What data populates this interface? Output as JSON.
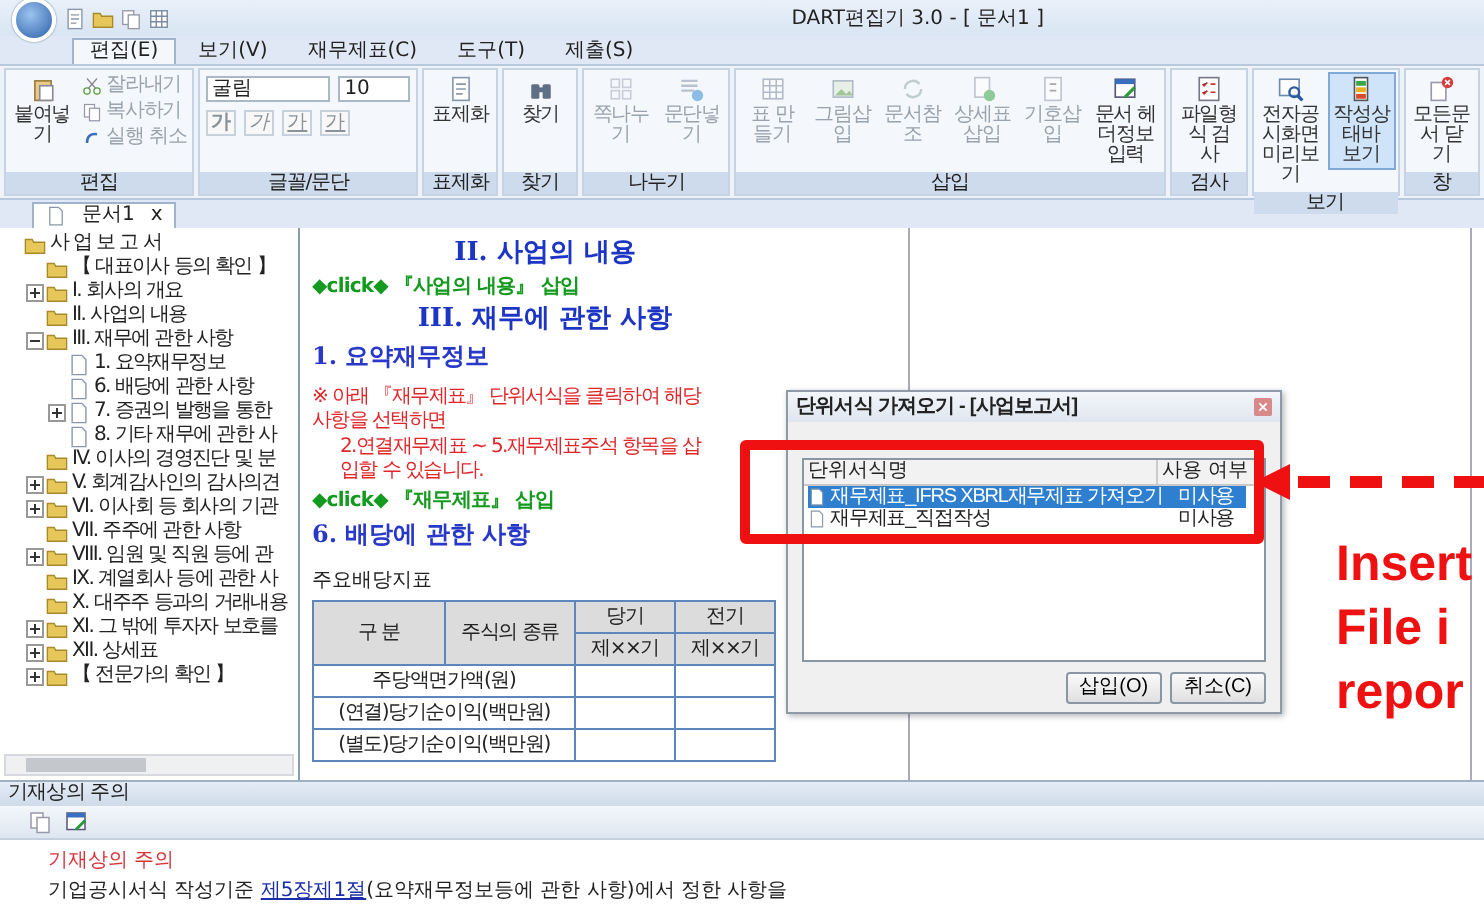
{
  "window": {
    "title": "DART편집기 3.0 - [ 문서1 ]"
  },
  "ribbon_tabs": [
    {
      "label": "편집(E)",
      "selected": true
    },
    {
      "label": "보기(V)",
      "selected": false
    },
    {
      "label": "재무제표(C)",
      "selected": false
    },
    {
      "label": "도구(T)",
      "selected": false
    },
    {
      "label": "제출(S)",
      "selected": false
    }
  ],
  "ribbon_groups": [
    {
      "label": "편집",
      "buttons": [
        {
          "label": "붙여넣기",
          "kind": "large",
          "disabled": false,
          "pressed": false
        },
        {
          "label": "잘라내기",
          "kind": "small",
          "disabled": true,
          "pressed": false
        },
        {
          "label": "복사하기",
          "kind": "small",
          "disabled": true,
          "pressed": false
        },
        {
          "label": "실행 취소",
          "kind": "small",
          "disabled": true,
          "pressed": false
        }
      ]
    },
    {
      "label": "글꼴/문단",
      "font_name": "굴림",
      "font_size": "10",
      "format_buttons": [
        "가",
        "가",
        "가",
        "가"
      ]
    },
    {
      "label": "표제화",
      "buttons": [
        {
          "label": "표제화",
          "kind": "large",
          "disabled": false,
          "pressed": false
        }
      ]
    },
    {
      "label": "찾기",
      "buttons": [
        {
          "label": "찾기",
          "kind": "large",
          "disabled": false,
          "pressed": false
        }
      ]
    },
    {
      "label": "나누기",
      "buttons": [
        {
          "label": "쪽나누기",
          "kind": "large",
          "disabled": true,
          "pressed": false
        },
        {
          "label": "문단넣기",
          "kind": "large",
          "disabled": true,
          "pressed": false
        }
      ]
    },
    {
      "label": "삽입",
      "buttons": [
        {
          "label": "표 만들기",
          "kind": "large",
          "disabled": true,
          "pressed": false
        },
        {
          "label": "그림삽입",
          "kind": "large",
          "disabled": true,
          "pressed": false
        },
        {
          "label": "문서참조",
          "kind": "large",
          "disabled": true,
          "pressed": false
        },
        {
          "label": "상세표삽입",
          "kind": "large",
          "disabled": true,
          "pressed": false
        },
        {
          "label": "기호삽입",
          "kind": "large",
          "disabled": true,
          "pressed": false
        },
        {
          "label": "문서 헤더정보 입력",
          "kind": "large",
          "disabled": false,
          "pressed": false
        }
      ]
    },
    {
      "label": "검사",
      "buttons": [
        {
          "label": "파일형식 검사",
          "kind": "large",
          "disabled": false,
          "pressed": false
        }
      ]
    },
    {
      "label": "보기",
      "buttons": [
        {
          "label": "전자공시화면 미리보기",
          "kind": "large",
          "disabled": false,
          "pressed": false
        },
        {
          "label": "작성상태바 보기",
          "kind": "large",
          "disabled": false,
          "pressed": true
        }
      ]
    },
    {
      "label": "창",
      "buttons": [
        {
          "label": "모든문서 닫기",
          "kind": "large",
          "disabled": false,
          "pressed": false
        }
      ]
    }
  ],
  "doc_tab": {
    "label": "문서1",
    "close": "x"
  },
  "tree": {
    "label": "사 업 보 고 서",
    "kind": "folder",
    "children": [
      {
        "label": "【 대표이사 등의 확인 】",
        "kind": "folder"
      },
      {
        "label": "I. 회사의 개요",
        "kind": "folder",
        "expanded": false
      },
      {
        "label": "II. 사업의 내용",
        "kind": "folder"
      },
      {
        "label": "III. 재무에 관한 사항",
        "kind": "folder",
        "expanded": true,
        "children": [
          {
            "label": "1. 요약재무정보",
            "kind": "page"
          },
          {
            "label": "6. 배당에 관한 사항",
            "kind": "page"
          },
          {
            "label": "7. 증권의 발행을 통한",
            "kind": "page",
            "expanded": false
          },
          {
            "label": "8. 기타 재무에 관한 사",
            "kind": "page"
          }
        ]
      },
      {
        "label": "IV. 이사의 경영진단 및 분",
        "kind": "folder"
      },
      {
        "label": "V. 회계감사인의 감사의견",
        "kind": "folder",
        "expanded": false
      },
      {
        "label": "VI. 이사회 등 회사의 기관",
        "kind": "folder",
        "expanded": false
      },
      {
        "label": "VII. 주주에 관한 사항",
        "kind": "folder"
      },
      {
        "label": "VIII. 임원 및 직원 등에 관",
        "kind": "folder",
        "expanded": false
      },
      {
        "label": "IX. 계열회사 등에 관한 사",
        "kind": "folder"
      },
      {
        "label": "X. 대주주 등과의 거래내용",
        "kind": "folder"
      },
      {
        "label": "XI. 그 밖에 투자자 보호를",
        "kind": "folder",
        "expanded": false
      },
      {
        "label": "XII. 상세표",
        "kind": "folder",
        "expanded": false
      },
      {
        "label": "【 전문가의 확인 】",
        "kind": "folder",
        "expanded": false
      }
    ]
  },
  "document": {
    "blocks": [
      {
        "kind": "title",
        "text": "II. 사업의 내용"
      },
      {
        "kind": "action",
        "text": "◆click◆ 『사업의 내용』 삽입"
      },
      {
        "kind": "title",
        "text": "III. 재무에 관한 사항"
      },
      {
        "kind": "heading",
        "text": "1. 요약재무정보"
      },
      {
        "kind": "note",
        "text": "※ 아래 『재무제표』 단위서식을 클릭하여 해당사항을 선택하면"
      },
      {
        "kind": "note",
        "text": "2.연결재무제표 ~ 5.재무제표주석 항목을 삽입할 수 있습니다."
      },
      {
        "kind": "action",
        "text": "◆click◆ 『재무제표』 삽입"
      },
      {
        "kind": "heading",
        "text": "6. 배당에 관한 사항"
      },
      {
        "kind": "caption",
        "text": "주요배당지표"
      }
    ],
    "table": {
      "header": [
        "구 분",
        "주식의 종류",
        "당기",
        "전기"
      ],
      "subheader": [
        "제××기",
        "제××기"
      ],
      "rows": [
        "주당액면가액(원)",
        "(연결)당기순이익(백만원)",
        "(별도)당기순이익(백만원)"
      ]
    }
  },
  "dialog": {
    "title": "단위서식 가져오기 - [사업보고서]",
    "columns": [
      "단위서식명",
      "사용 여부"
    ],
    "rows": [
      {
        "name": "재무제표_IFRS XBRL재무제표 가져오기",
        "usage": "미사용",
        "selected": true
      },
      {
        "name": "재무제표_직접작성",
        "usage": "미사용",
        "selected": false
      }
    ],
    "buttons": [
      "삽입(O)",
      "취소(C)"
    ]
  },
  "annotation": {
    "lines": [
      "Insert",
      "File i",
      "repor"
    ]
  },
  "notes_panel": {
    "title": "기재상의 주의",
    "heading": "기재상의 주의",
    "text_before": "기업공시서식 작성기준 ",
    "link": "제5장제1절",
    "text_after": "(요약재무정보등에 관한 사항)에서 정한 사항을"
  }
}
